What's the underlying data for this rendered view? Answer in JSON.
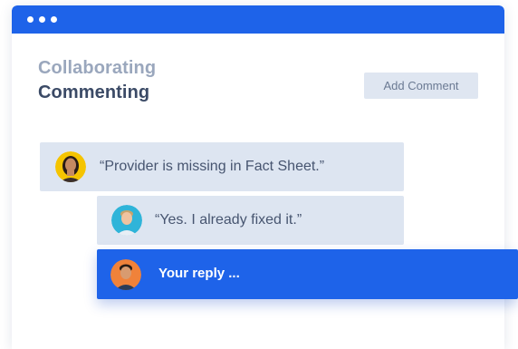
{
  "header": {
    "title_line1": "Collaborating",
    "title_line2": "Commenting"
  },
  "toolbar": {
    "add_comment_label": "Add Comment"
  },
  "comments": [
    {
      "text": "“Provider is missing in Fact Sheet.”",
      "avatar": "woman-avatar"
    },
    {
      "text": "“Yes. I already fixed it.”",
      "avatar": "man-avatar"
    }
  ],
  "reply": {
    "placeholder": "Your reply ...",
    "avatar": "user-avatar"
  },
  "colors": {
    "accent": "#1e63e9",
    "bubble": "#dde5f1",
    "title_light": "#9aa7bd",
    "title_dark": "#3b4a66"
  }
}
